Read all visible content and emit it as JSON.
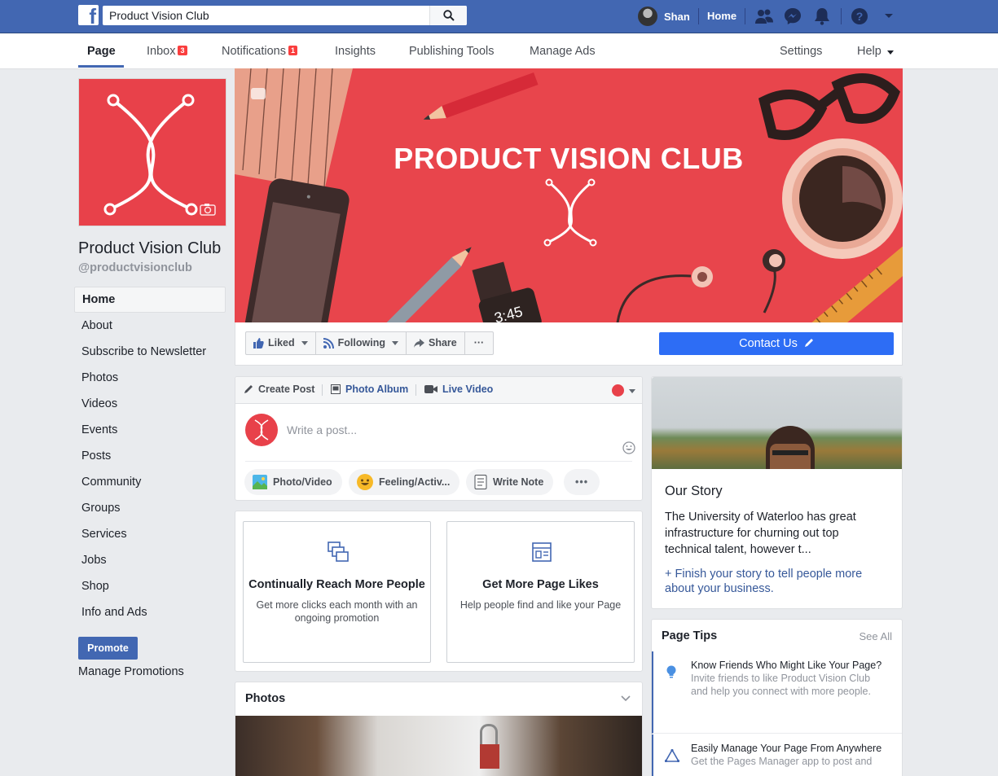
{
  "topbar": {
    "search_value": "Product Vision Club",
    "user_name": "Shan",
    "home_label": "Home",
    "brand_color": "#4267b2"
  },
  "page_nav": {
    "items": [
      {
        "label": "Page"
      },
      {
        "label": "Inbox",
        "badge": "3"
      },
      {
        "label": "Notifications",
        "badge": "1"
      },
      {
        "label": "Insights"
      },
      {
        "label": "Publishing Tools"
      },
      {
        "label": "Manage Ads"
      }
    ],
    "settings_label": "Settings",
    "help_label": "Help"
  },
  "page": {
    "name": "Product Vision Club",
    "handle": "@productvisionclub",
    "cover_title": "PRODUCT VISION CLUB",
    "cover_clock": "3:45",
    "accent_color": "#e8454c"
  },
  "left_nav": [
    "Home",
    "About",
    "Subscribe to Newsletter",
    "Photos",
    "Videos",
    "Events",
    "Posts",
    "Community",
    "Groups",
    "Services",
    "Jobs",
    "Shop",
    "Info and Ads"
  ],
  "promote_label": "Promote",
  "manage_promotions_label": "Manage Promotions",
  "action_bar": {
    "liked": "Liked",
    "following": "Following",
    "share": "Share",
    "more": "···",
    "contact": "Contact Us"
  },
  "composer": {
    "create_post": "Create Post",
    "photo_album": "Photo Album",
    "live_video": "Live Video",
    "placeholder": "Write a post...",
    "photo_video": "Photo/Video",
    "feeling": "Feeling/Activ...",
    "write_note": "Write Note",
    "more": "•••"
  },
  "promos": [
    {
      "title": "Continually Reach More People",
      "desc": "Get more clicks each month with an ongoing promotion"
    },
    {
      "title": "Get More Page Likes",
      "desc": "Help people find and like your Page"
    }
  ],
  "photos_section": {
    "title": "Photos"
  },
  "story": {
    "title": "Our Story",
    "body": "The University of Waterloo has great infrastructure for churning out top technical talent, however t...",
    "link": "+ Finish your story to tell people more about your business."
  },
  "tips": {
    "title": "Page Tips",
    "see_all": "See All",
    "items": [
      {
        "title": "Know Friends Who Might Like Your Page?",
        "desc": "Invite friends to like Product Vision Club and help you connect with more people."
      },
      {
        "title": "Easily Manage Your Page From Anywhere",
        "desc": "Get the Pages Manager app to post and"
      }
    ]
  }
}
